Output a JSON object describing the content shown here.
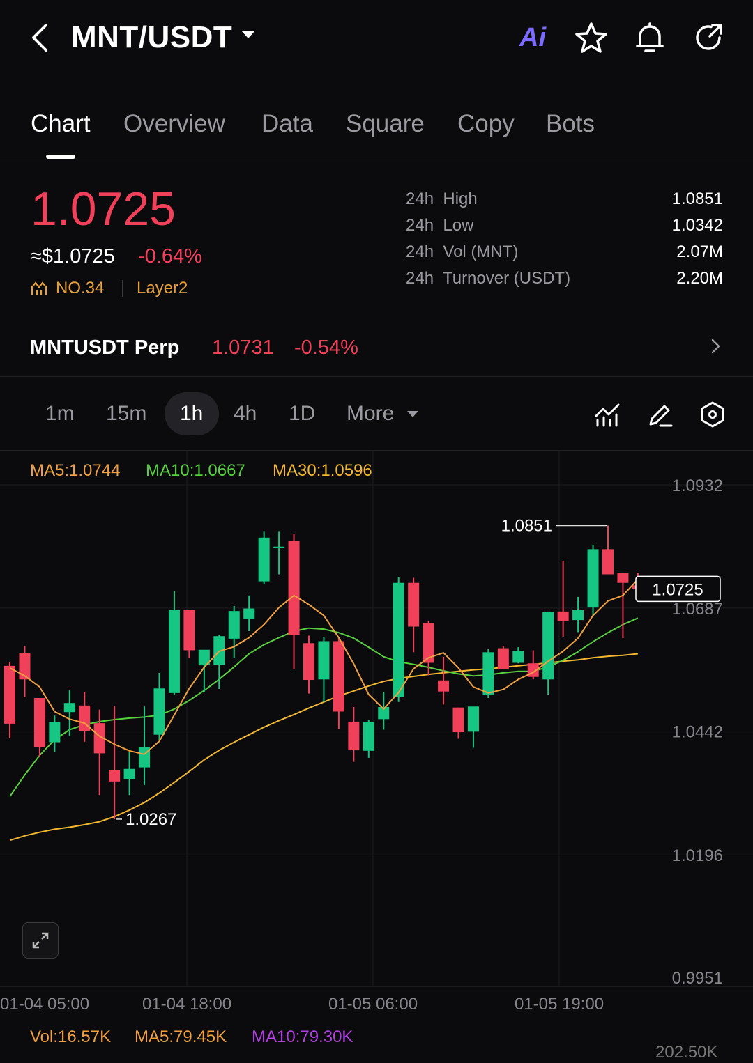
{
  "header": {
    "pair": "MNT/USDT",
    "icons": [
      "back-icon",
      "dropdown-caret-icon",
      "ai-icon",
      "star-icon",
      "bell-icon",
      "share-icon"
    ],
    "ai_label": "Ai"
  },
  "tabs": [
    {
      "label": "Chart",
      "active": true
    },
    {
      "label": "Overview"
    },
    {
      "label": "Data"
    },
    {
      "label": "Square"
    },
    {
      "label": "Copy"
    },
    {
      "label": "Bots"
    }
  ],
  "ticker": {
    "price": "1.0725",
    "usd_price": "≈$1.0725",
    "change": "-0.64%",
    "rank": "NO.34",
    "tag": "Layer2",
    "stats": [
      {
        "label": "24h  High",
        "value": "1.0851"
      },
      {
        "label": "24h  Low",
        "value": "1.0342"
      },
      {
        "label": "24h  Vol (MNT)",
        "value": "2.07M"
      },
      {
        "label": "24h  Turnover (USDT)",
        "value": "2.20M"
      }
    ]
  },
  "perp": {
    "label": "MNTUSDT Perp",
    "price": "1.0731",
    "change": "-0.54%"
  },
  "intervals": [
    {
      "label": "1m"
    },
    {
      "label": "15m"
    },
    {
      "label": "1h",
      "active": true
    },
    {
      "label": "4h"
    },
    {
      "label": "1D"
    },
    {
      "label": "More"
    }
  ],
  "toolbar_icons": [
    "indicators-icon",
    "draw-icon",
    "settings-hex-icon"
  ],
  "ma_legend": {
    "ma5": "MA5:1.0744",
    "ma10": "MA10:1.0667",
    "ma30": "MA30:1.0596"
  },
  "volume_legend": {
    "vol": "Vol:16.57K",
    "ma5": "MA5:79.45K",
    "ma10": "MA10:79.30K",
    "cut_value": "202.50K"
  },
  "colors": {
    "up": "#16c784",
    "down": "#f0405a",
    "ma5": "#f0a040",
    "ma10": "#58d040",
    "ma30": "#f2b832",
    "vol_ma10": "#b040e0",
    "accent_ai": "#7b6bff"
  },
  "chart_data": {
    "type": "candlestick",
    "interval": "1h",
    "y_ticks": [
      "1.0932",
      "1.0687",
      "1.0442",
      "1.0196",
      "0.9951"
    ],
    "ylim": [
      0.9951,
      1.0932
    ],
    "x_ticks": [
      "01-04 05:00",
      "01-04 18:00",
      "01-05 06:00",
      "01-05 19:00"
    ],
    "last_price": "1.0725",
    "high_label": "1.0851",
    "low_label": "1.0267",
    "candles": [
      {
        "o": 1.0572,
        "h": 1.0579,
        "l": 1.0428,
        "c": 1.0457
      },
      {
        "o": 1.0598,
        "h": 1.0611,
        "l": 1.051,
        "c": 1.0545
      },
      {
        "o": 1.0508,
        "h": 1.0508,
        "l": 1.039,
        "c": 1.0411
      },
      {
        "o": 1.042,
        "h": 1.0473,
        "l": 1.04,
        "c": 1.046
      },
      {
        "o": 1.048,
        "h": 1.0523,
        "l": 1.0433,
        "c": 1.0498
      },
      {
        "o": 1.0493,
        "h": 1.052,
        "l": 1.0421,
        "c": 1.0442
      },
      {
        "o": 1.0458,
        "h": 1.0485,
        "l": 1.0315,
        "c": 1.0398
      },
      {
        "o": 1.0365,
        "h": 1.0492,
        "l": 1.0267,
        "c": 1.0342
      },
      {
        "o": 1.0346,
        "h": 1.0401,
        "l": 1.0315,
        "c": 1.0367
      },
      {
        "o": 1.037,
        "h": 1.0491,
        "l": 1.0335,
        "c": 1.0411
      },
      {
        "o": 1.0435,
        "h": 1.0558,
        "l": 1.0424,
        "c": 1.0527
      },
      {
        "o": 1.0518,
        "h": 1.0721,
        "l": 1.0514,
        "c": 1.0683
      },
      {
        "o": 1.0683,
        "h": 1.0684,
        "l": 1.0588,
        "c": 1.0603
      },
      {
        "o": 1.0573,
        "h": 1.0598,
        "l": 1.0519,
        "c": 1.0604
      },
      {
        "o": 1.0574,
        "h": 1.0633,
        "l": 1.0526,
        "c": 1.0631
      },
      {
        "o": 1.0626,
        "h": 1.0691,
        "l": 1.0587,
        "c": 1.0681
      },
      {
        "o": 1.0666,
        "h": 1.0712,
        "l": 1.0641,
        "c": 1.0686
      },
      {
        "o": 1.074,
        "h": 1.084,
        "l": 1.0734,
        "c": 1.0827
      },
      {
        "o": 1.0806,
        "h": 1.084,
        "l": 1.0754,
        "c": 1.0809
      },
      {
        "o": 1.0821,
        "h": 1.0835,
        "l": 1.0565,
        "c": 1.0633
      },
      {
        "o": 1.0617,
        "h": 1.0632,
        "l": 1.0517,
        "c": 1.0544
      },
      {
        "o": 1.0545,
        "h": 1.063,
        "l": 1.05,
        "c": 1.0621
      },
      {
        "o": 1.0621,
        "h": 1.0628,
        "l": 1.0446,
        "c": 1.0481
      },
      {
        "o": 1.0461,
        "h": 1.049,
        "l": 1.0381,
        "c": 1.0404
      },
      {
        "o": 1.0403,
        "h": 1.0464,
        "l": 1.0389,
        "c": 1.046
      },
      {
        "o": 1.0466,
        "h": 1.052,
        "l": 1.0445,
        "c": 1.049
      },
      {
        "o": 1.051,
        "h": 1.0749,
        "l": 1.05,
        "c": 1.0737
      },
      {
        "o": 1.0737,
        "h": 1.0747,
        "l": 1.0599,
        "c": 1.065
      },
      {
        "o": 1.0657,
        "h": 1.0662,
        "l": 1.0553,
        "c": 1.0578
      },
      {
        "o": 1.0543,
        "h": 1.059,
        "l": 1.0495,
        "c": 1.0521
      },
      {
        "o": 1.0489,
        "h": 1.0489,
        "l": 1.0427,
        "c": 1.044
      },
      {
        "o": 1.0441,
        "h": 1.048,
        "l": 1.0409,
        "c": 1.0491
      },
      {
        "o": 1.0515,
        "h": 1.0605,
        "l": 1.0508,
        "c": 1.0599
      },
      {
        "o": 1.0607,
        "h": 1.0611,
        "l": 1.0566,
        "c": 1.0565
      },
      {
        "o": 1.0578,
        "h": 1.0609,
        "l": 1.0577,
        "c": 1.0602
      },
      {
        "o": 1.0577,
        "h": 1.0603,
        "l": 1.0545,
        "c": 1.055
      },
      {
        "o": 1.0545,
        "h": 1.068,
        "l": 1.0515,
        "c": 1.0679
      },
      {
        "o": 1.068,
        "h": 1.0781,
        "l": 1.063,
        "c": 1.0661
      },
      {
        "o": 1.0663,
        "h": 1.0709,
        "l": 1.0639,
        "c": 1.0684
      },
      {
        "o": 1.0688,
        "h": 1.0813,
        "l": 1.0672,
        "c": 1.0804
      },
      {
        "o": 1.0804,
        "h": 1.0851,
        "l": 1.0761,
        "c": 1.0754
      },
      {
        "o": 1.0757,
        "h": 1.0757,
        "l": 1.0627,
        "c": 1.0737
      },
      {
        "o": 1.0732,
        "h": 1.0757,
        "l": 1.0704,
        "c": 1.0725
      }
    ],
    "ma5": [
      1.0568,
      1.0552,
      1.053,
      1.0481,
      1.0466,
      1.0458,
      1.0432,
      1.0416,
      1.0403,
      1.0396,
      1.0422,
      1.0474,
      1.0527,
      1.0569,
      1.0601,
      1.061,
      1.0628,
      1.0654,
      1.0688,
      1.0712,
      1.0694,
      1.0672,
      1.0628,
      1.0576,
      1.0515,
      1.0486,
      1.0519,
      1.0566,
      1.0588,
      1.0598,
      1.0568,
      1.053,
      1.0518,
      1.0525,
      1.0545,
      1.0559,
      1.0581,
      1.0601,
      1.0627,
      1.0672,
      1.0701,
      1.0712,
      1.0744
    ],
    "ma10": [
      1.0312,
      1.0355,
      1.0394,
      1.0425,
      1.0445,
      1.0455,
      1.0461,
      1.0465,
      1.0468,
      1.047,
      1.0474,
      1.0486,
      1.0503,
      1.0523,
      1.0545,
      1.057,
      1.0596,
      1.0614,
      1.0628,
      1.0641,
      1.0647,
      1.0645,
      1.0638,
      1.0627,
      1.0609,
      1.059,
      1.058,
      1.0575,
      1.0569,
      1.0562,
      1.0556,
      1.0552,
      1.0554,
      1.0558,
      1.0561,
      1.0561,
      1.057,
      1.0583,
      1.06,
      1.062,
      1.0638,
      1.0654,
      1.0667
    ],
    "ma30": [
      1.0225,
      1.0234,
      1.0241,
      1.0247,
      1.0251,
      1.0256,
      1.0262,
      1.0272,
      1.0285,
      1.03,
      1.0319,
      1.034,
      1.0362,
      1.0385,
      1.0404,
      1.042,
      1.0435,
      1.045,
      1.0463,
      1.0475,
      1.0488,
      1.05,
      1.0512,
      1.0522,
      1.0532,
      1.0541,
      1.0547,
      1.0551,
      1.0555,
      1.0558,
      1.0561,
      1.0564,
      1.0566,
      1.0569,
      1.0572,
      1.0575,
      1.0578,
      1.0581,
      1.0584,
      1.0588,
      1.0591,
      1.0593,
      1.0596
    ]
  }
}
